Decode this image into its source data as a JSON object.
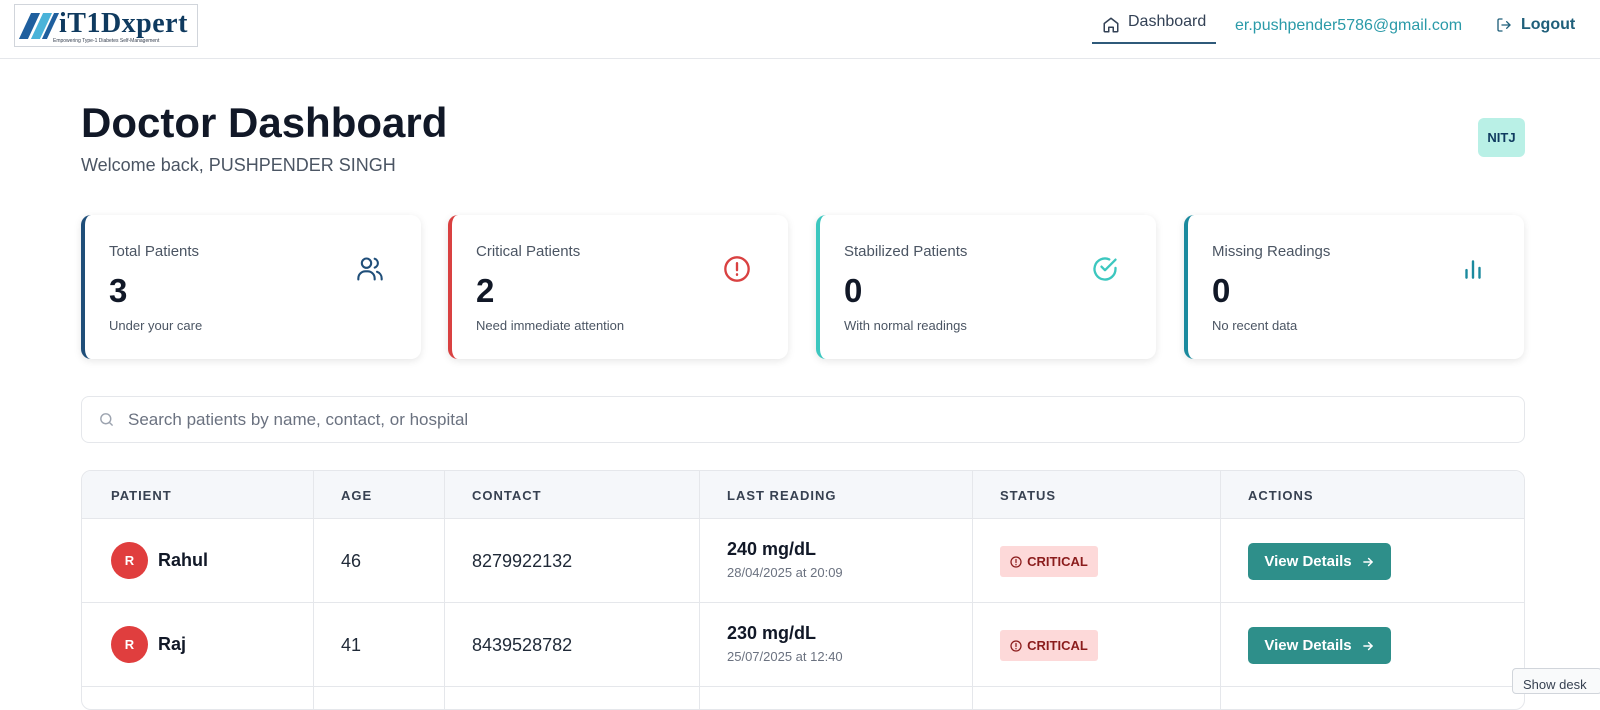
{
  "header": {
    "logo_text": "iT1Dxpert",
    "logo_tagline": "Empowering Type-1 Diabetes Self-Management",
    "nav_dashboard": "Dashboard",
    "user_email": "er.pushpender5786@gmail.com",
    "logout_label": "Logout"
  },
  "page": {
    "title": "Doctor Dashboard",
    "welcome": "Welcome back, PUSHPENDER SINGH",
    "org_badge": "NITJ"
  },
  "cards": [
    {
      "title": "Total Patients",
      "value": "3",
      "subtitle": "Under your care",
      "icon": "users-icon",
      "color": "#1f4e79"
    },
    {
      "title": "Critical Patients",
      "value": "2",
      "subtitle": "Need immediate attention",
      "icon": "alert-circle-icon",
      "color": "#d94141"
    },
    {
      "title": "Stabilized Patients",
      "value": "0",
      "subtitle": "With normal readings",
      "icon": "check-circle-icon",
      "color": "#3cc7bf"
    },
    {
      "title": "Missing Readings",
      "value": "0",
      "subtitle": "No recent data",
      "icon": "bar-chart-icon",
      "color": "#1b8a9e"
    }
  ],
  "search": {
    "placeholder": "Search patients by name, contact, or hospital"
  },
  "table": {
    "headers": [
      "PATIENT",
      "AGE",
      "CONTACT",
      "LAST READING",
      "STATUS",
      "ACTIONS"
    ],
    "rows": [
      {
        "initial": "R",
        "name": "Rahul",
        "age": "46",
        "contact": "8279922132",
        "reading": "240 mg/dL",
        "reading_time": "28/04/2025 at 20:09",
        "status": "CRITICAL",
        "action": "View Details"
      },
      {
        "initial": "R",
        "name": "Raj",
        "age": "41",
        "contact": "8439528782",
        "reading": "230 mg/dL",
        "reading_time": "25/07/2025 at 12:40",
        "status": "CRITICAL",
        "action": "View Details"
      }
    ]
  },
  "overlay": {
    "show_desktop": "Show desk"
  },
  "colors": {
    "accent": "#2e8f8a",
    "critical_bg": "#fdd9d9",
    "critical_text": "#8b1c1c",
    "nav_text": "#2a9aa8"
  }
}
